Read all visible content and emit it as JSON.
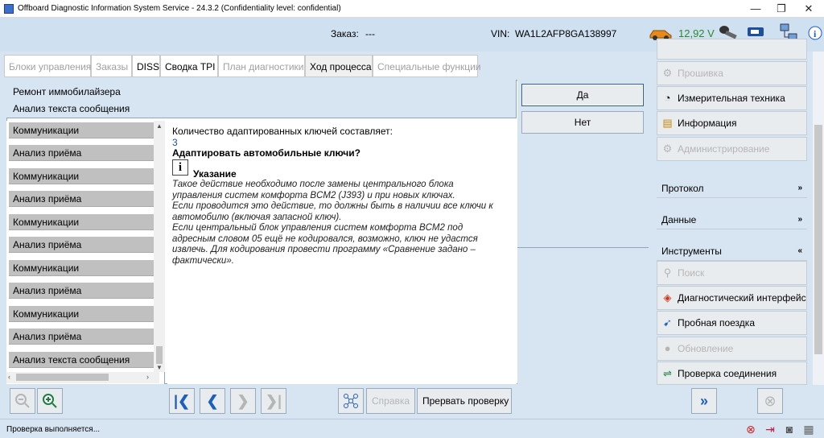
{
  "window": {
    "title": "Offboard Diagnostic Information System Service - 24.3.2 (Confidentiality level: confidential)",
    "minimize": "—",
    "maximize": "❐",
    "close": "✕"
  },
  "header": {
    "order_label": "Заказ:",
    "order_value": "---",
    "vin_label": "VIN:",
    "vin_value": "WA1L2AFP8GA138997",
    "voltage": "12,92 V"
  },
  "tabs": [
    {
      "label": "Блоки управления",
      "enabled": false
    },
    {
      "label": "Заказы",
      "enabled": false
    },
    {
      "label": "DISS",
      "enabled": true
    },
    {
      "label": "Сводка TPI",
      "enabled": true
    },
    {
      "label": "План диагностики",
      "enabled": false
    },
    {
      "label": "Ход процесса",
      "enabled": true,
      "selected": true
    },
    {
      "label": "Специальные функции",
      "enabled": false
    }
  ],
  "breadcrumbs": [
    "Ремонт иммобилайзера",
    "Анализ текста сообщения"
  ],
  "steps": [
    "Коммуникации",
    "Анализ приёма",
    "Коммуникации",
    "Анализ приёма",
    "Коммуникации",
    "Анализ приёма",
    "Коммуникации",
    "Анализ приёма",
    "Коммуникации",
    "Анализ приёма",
    "Анализ текста сообщения"
  ],
  "message": {
    "line1": "Количество адаптированных ключей составляет:",
    "value": "3",
    "question": "Адаптировать автомобильные ключи?",
    "info_symbol": "i",
    "note_title": "Указание",
    "note_lines": [
      "Такое действие необходимо после замены центрального блока",
      "управления систем комфорта BCM2 (J393) и при новых ключах.",
      "Если проводится это действие, то должны быть в наличии все ключи к",
      "автомобилю (включая запасной ключ).",
      "Если центральный блок управления систем комфорта BCM2 под",
      "адресным словом 05 ещё не кодировался, возможно, ключ не удастся",
      "извлечь. Для кодирования провести программу «Сравнение задано –",
      "фактически»."
    ]
  },
  "dialog_buttons": {
    "yes": "Да",
    "no": "Нет"
  },
  "bottom_toolbar": {
    "help": "Справка",
    "abort": "Прервать проверку"
  },
  "right_panel": {
    "top_items": [
      {
        "label": "Прошивка",
        "enabled": false,
        "icon": "flash-icon"
      },
      {
        "label": "Измерительная техника",
        "enabled": true,
        "icon": "gauge-icon"
      },
      {
        "label": "Информация",
        "enabled": true,
        "icon": "book-icon"
      },
      {
        "label": "Администрирование",
        "enabled": false,
        "icon": "admin-icon"
      }
    ],
    "sections": {
      "protocol": "Протокол",
      "data": "Данные",
      "tools": "Инструменты"
    },
    "tool_items": [
      {
        "label": "Поиск",
        "enabled": false,
        "icon": "search-icon"
      },
      {
        "label": "Диагностический интерфейс",
        "enabled": true,
        "icon": "interface-icon"
      },
      {
        "label": "Пробная поездка",
        "enabled": true,
        "icon": "test-drive-icon"
      },
      {
        "label": "Обновление",
        "enabled": false,
        "icon": "update-icon"
      },
      {
        "label": "Проверка соединения",
        "enabled": true,
        "icon": "connection-icon"
      }
    ]
  },
  "status": {
    "text": "Проверка выполняется..."
  },
  "colors": {
    "accent": "#1d5fbf",
    "voltage": "#2a8a2a",
    "panel": "#d7e4f2"
  }
}
